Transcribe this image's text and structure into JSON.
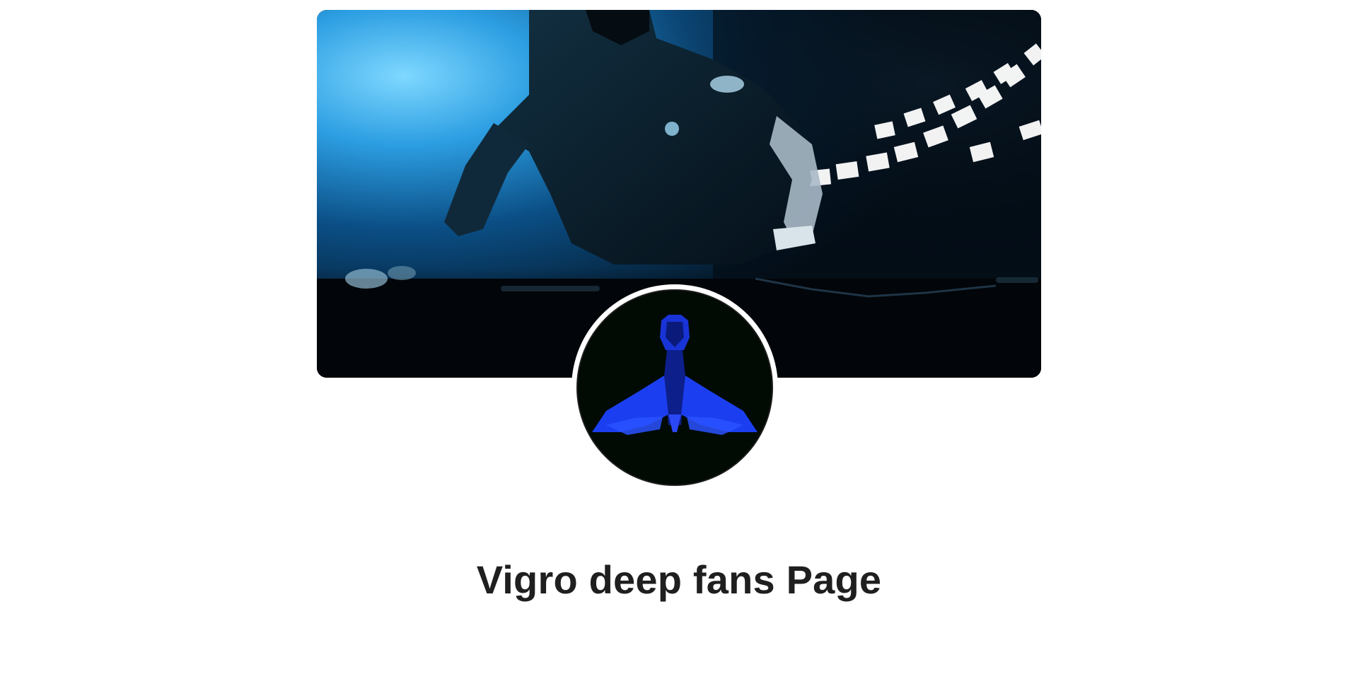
{
  "profile": {
    "page_name": "Vigro deep fans Page",
    "cover_image": "dj-performing-blue-stage-lights",
    "avatar_image": "blue-abstract-figure-on-black"
  },
  "colors": {
    "background": "#ffffff",
    "title_text": "#1f1f1f",
    "cover_accent": "#1a8fd8",
    "avatar_accent": "#1530e8"
  }
}
